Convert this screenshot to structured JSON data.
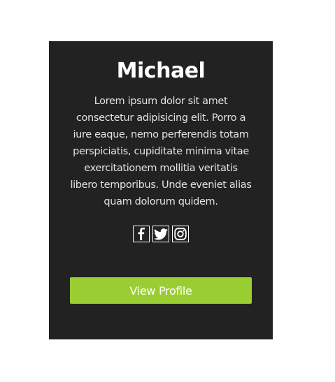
{
  "card": {
    "name": "Michael",
    "bio": "Lorem ipsum dolor sit amet consectetur adipisicing elit. Porro a iure eaque, nemo perferendis totam perspiciatis, cupiditate minima vitae exercitationem mollitia veritatis libero temporibus. Unde eveniet alias quam dolorum quidem.",
    "socials": [
      {
        "icon": "facebook-icon"
      },
      {
        "icon": "twitter-icon"
      },
      {
        "icon": "instagram-icon"
      }
    ],
    "button_label": "View Profile"
  },
  "colors": {
    "card_background": "#222222",
    "accent": "#9acd32",
    "text": "#ffffff",
    "page_background": "#ffffff"
  }
}
